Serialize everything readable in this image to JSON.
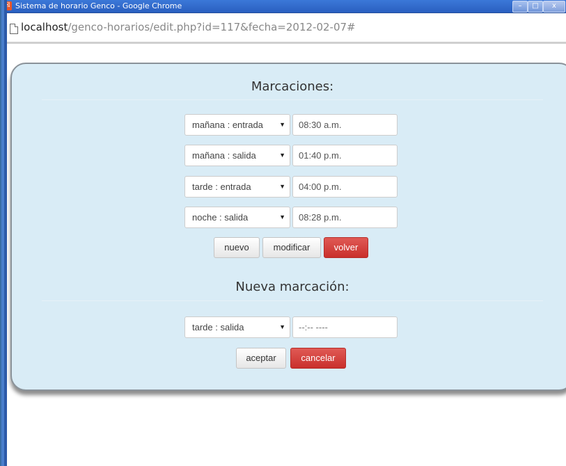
{
  "window": {
    "title": "Sistema de horario Genco - Google Chrome",
    "app_icon_glyph": "☒",
    "controls": {
      "minimize": "–",
      "maximize": "□",
      "close": "x"
    }
  },
  "address": {
    "host": "localhost",
    "path": "/genco-horarios/edit.php?id=117&fecha=2012-02-07#"
  },
  "marcaciones": {
    "title": "Marcaciones:",
    "rows": [
      {
        "select": "mañana : entrada",
        "time": "08:30 a.m."
      },
      {
        "select": "mañana : salida",
        "time": "01:40 p.m."
      },
      {
        "select": "tarde : entrada",
        "time": "04:00 p.m."
      },
      {
        "select": "noche : salida",
        "time": "08:28 p.m."
      }
    ],
    "buttons": {
      "nuevo": "nuevo",
      "modificar": "modificar",
      "volver": "volver"
    }
  },
  "nueva": {
    "title": "Nueva marcación:",
    "select": "tarde : salida",
    "time_placeholder": "--:-- ----",
    "buttons": {
      "aceptar": "aceptar",
      "cancelar": "cancelar"
    }
  },
  "colors": {
    "panel_bg": "#d9ecf6",
    "danger": "#c9302c",
    "titlebar": "#2a5fc0"
  }
}
